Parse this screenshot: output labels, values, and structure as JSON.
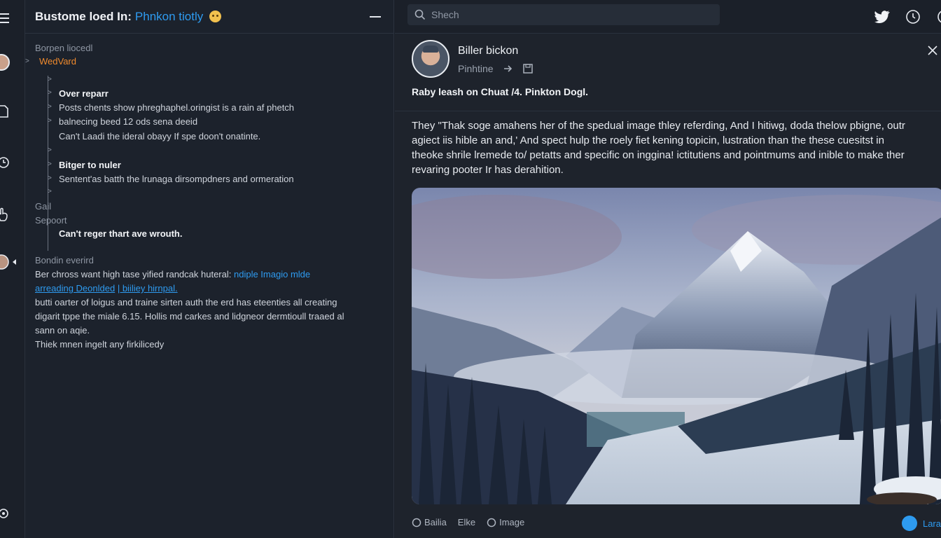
{
  "header": {
    "title": "Bustome loed In:",
    "subtitle": "Phnkon tiotly"
  },
  "thread": {
    "section1_label": "Borpen liocedl",
    "active_item": "WedVard",
    "block1": {
      "title": "Over reparr",
      "lines": [
        "Posts chents show phreghaphel.oringist is a rain af phetch",
        "balnecing beed 12 ods sena deeid",
        "Can't Laadi the ideral obayy If spe doon't onatinte."
      ]
    },
    "block2": {
      "title": "Bitger to nuler",
      "lines": [
        "Sentent'as batth the lrunaga dirsompdners and ormeration"
      ]
    },
    "label_gal": "Gail",
    "label_support": "Sepoort",
    "support_line": "Can't reger thart ave wrouth.",
    "section2_label": "Bondin everird",
    "para": {
      "l1_pre": "Ber chross want high tase yified randcak huteral:",
      "l1_link": "ndiple Imagio mlde",
      "l2_link": "arreading Deonlded",
      "l2_tail": "| biiliey hirnpal.",
      "l3": "butti oarter of loigus and traine sirten auth the erd has eteenties all creating",
      "l4": "digarit tppe the miale 6.15. Hollis md carkes and lidgneor dermtioull traaed al",
      "l5": "sann on aqie.",
      "l6": "Thiek mnen ingelt any firkilicedy"
    }
  },
  "search": {
    "placeholder": "Shech"
  },
  "post": {
    "author": "Biller bickon",
    "handle": "Pinhtine",
    "title": "Raby leash on Chuat /4. Pinkton Dogl.",
    "body": [
      "They \"Thak soge amahens her of the spedual image thley referding, And I hitiwg, doda thelow pbigne, outr",
      "agiect iis hible an and,' And spect hulp the roely fiet kening topicin, lustration than the these cuesitst in",
      "theoke shrile lremede to/ petatts and specific on inggina! ictitutiens and pointmums and inible to make ther",
      "revaring pooter Ir has derahition."
    ],
    "actions": {
      "comment": "Bailia",
      "like": "Elke",
      "image": "Image"
    },
    "live": "Lara"
  },
  "colors": {
    "accent": "#2e9bf0",
    "orange": "#f08a2c",
    "bg": "#1c222c"
  }
}
